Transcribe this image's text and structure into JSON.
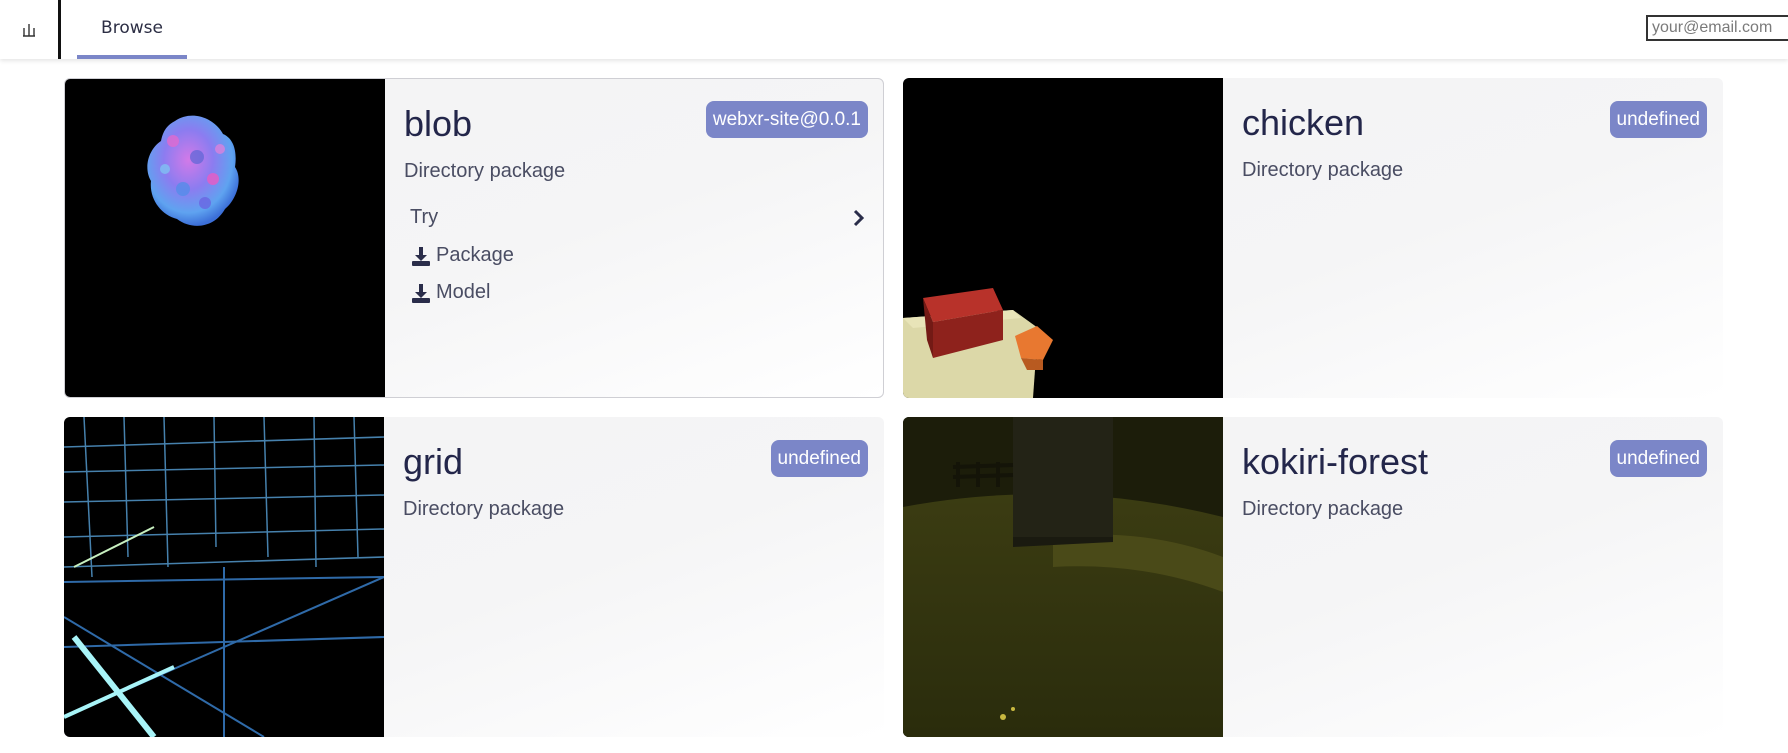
{
  "header": {
    "logo_icon": "chart-logo-icon",
    "tabs": [
      {
        "label": "Browse",
        "active": true
      }
    ],
    "email_placeholder": "your@email.com"
  },
  "accent_color": "#7b86c8",
  "packages": [
    {
      "name": "blob",
      "badge": "webxr-site@0.0.1",
      "type": "Directory package",
      "actions": {
        "try": "Try",
        "package": "Package",
        "model": "Model"
      }
    },
    {
      "name": "chicken",
      "badge": "undefined",
      "type": "Directory package"
    },
    {
      "name": "grid",
      "badge": "undefined",
      "type": "Directory package"
    },
    {
      "name": "kokiri-forest",
      "badge": "undefined",
      "type": "Directory package"
    }
  ]
}
